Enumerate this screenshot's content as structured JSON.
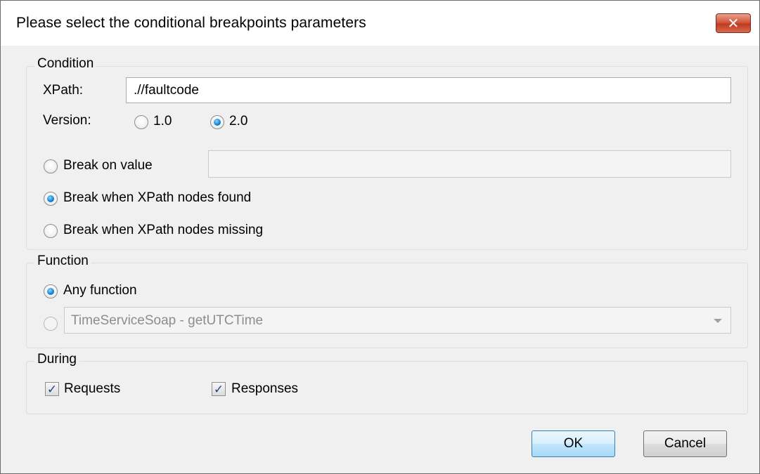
{
  "window": {
    "title": "Please select the conditional breakpoints parameters",
    "close_glyph": "✕"
  },
  "condition": {
    "legend": "Condition",
    "xpath_label": "XPath:",
    "xpath_value": ".//faultcode",
    "version_label": "Version:",
    "version_options": [
      "1.0",
      "2.0"
    ],
    "version_selected": "2.0",
    "break_on_value_label": "Break on value",
    "break_on_value_input": "",
    "nodes_found_label": "Break when XPath nodes found",
    "nodes_missing_label": "Break when XPath nodes missing",
    "selected_mode": "nodes_found"
  },
  "function": {
    "legend": "Function",
    "any_function_label": "Any function",
    "specific_function_value": "TimeServiceSoap - getUTCTime",
    "selected": "any_function"
  },
  "during": {
    "legend": "During",
    "requests_label": "Requests",
    "requests_checked": true,
    "responses_label": "Responses",
    "responses_checked": true,
    "check_glyph": "✓"
  },
  "buttons": {
    "ok_label": "OK",
    "cancel_label": "Cancel"
  },
  "colors": {
    "close_button": "#c13a21",
    "radio_selected": "#1a86d6",
    "default_button_border": "#3c7fb1"
  }
}
